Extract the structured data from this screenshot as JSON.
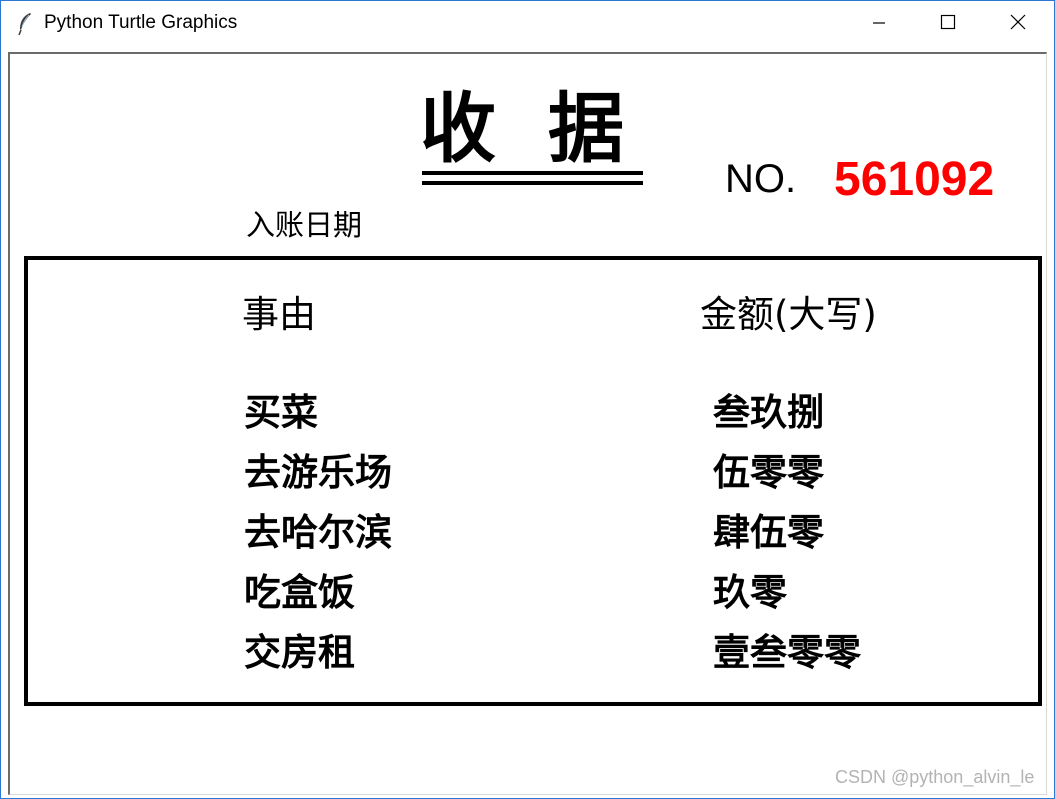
{
  "window": {
    "title": "Python Turtle Graphics",
    "icon": "feather-icon"
  },
  "controls": {
    "minimize_icon": "minimize-icon",
    "maximize_icon": "maximize-icon",
    "close_icon": "close-icon"
  },
  "receipt": {
    "title": "收据",
    "number_label": "NO.",
    "number_value": "561092",
    "number_color": "#ff0000",
    "date_label": "入账日期",
    "headers": {
      "reason": "事由",
      "amount": "金额(大写)"
    },
    "rows": [
      {
        "reason": "买菜",
        "amount": "叁玖捌"
      },
      {
        "reason": "去游乐场",
        "amount": "伍零零"
      },
      {
        "reason": "去哈尔滨",
        "amount": "肆伍零"
      },
      {
        "reason": "吃盒饭",
        "amount": "玖零"
      },
      {
        "reason": "交房租",
        "amount": "壹叁零零"
      }
    ]
  },
  "watermark": "CSDN @python_alvin_le"
}
